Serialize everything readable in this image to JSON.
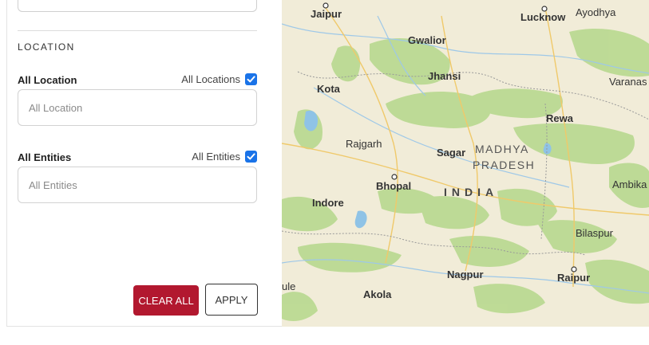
{
  "location_section": {
    "title": "LOCATION",
    "location_field": {
      "label": "All Location",
      "checkbox_label": "All Locations",
      "checked": true,
      "placeholder": "All Location"
    },
    "entities_field": {
      "label": "All Entities",
      "checkbox_label": "All Entities",
      "checked": true,
      "placeholder": "All Entities"
    }
  },
  "actions": {
    "clear_label": "CLEAR ALL",
    "apply_label": "APPLY"
  },
  "colors": {
    "clear_button": "#b2182f",
    "checkbox": "#1a73e8",
    "map_land": "#f1ecd8",
    "map_forest": "#b8d98f",
    "map_water": "#8fc3e6"
  },
  "map": {
    "cities": [
      "Jaipur",
      "Lucknow",
      "Ayodhya",
      "Gwalior",
      "Jhansi",
      "Varanas",
      "Kota",
      "Rewa",
      "Rajgarh",
      "Sagar",
      "Bhopal",
      "Ambika",
      "Indore",
      "Bilaspur",
      "Nagpur",
      "Raipur",
      "ule",
      "Akola"
    ],
    "region_line1": "MADHYA",
    "region_line2": "PRADESH",
    "country": "INDIA"
  }
}
